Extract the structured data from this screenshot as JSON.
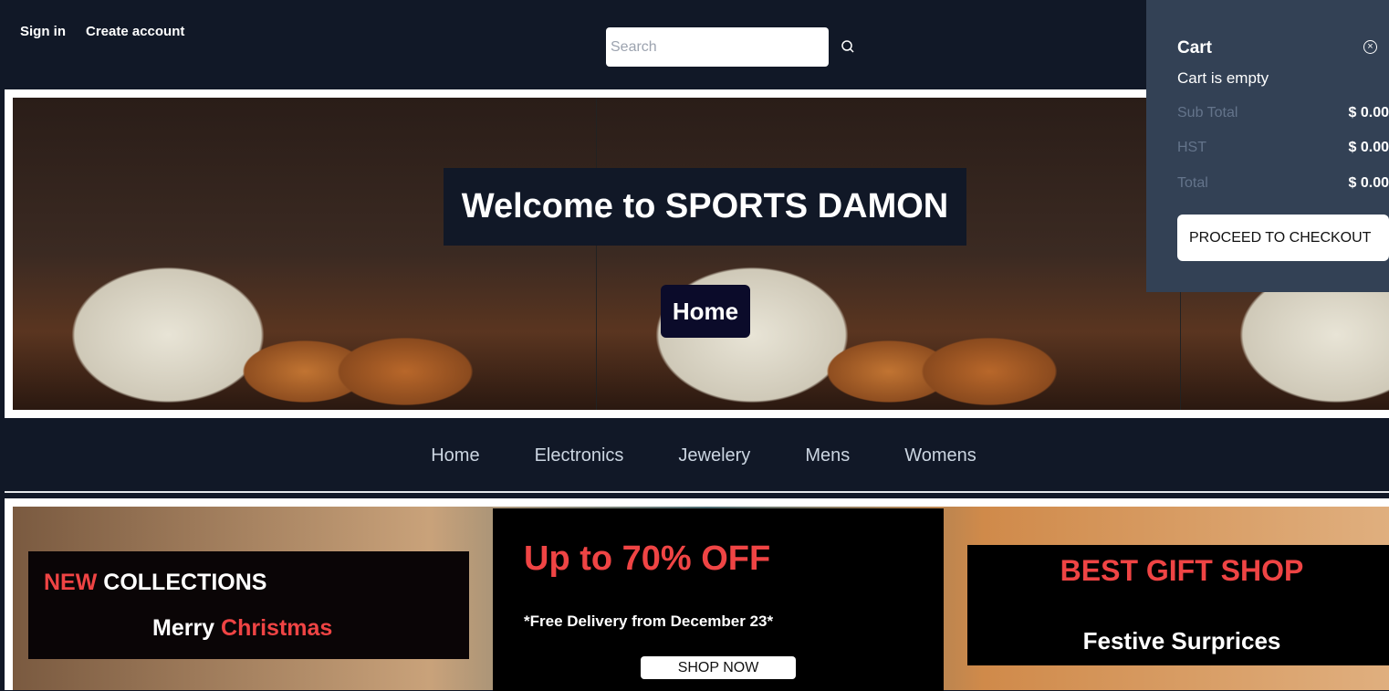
{
  "header": {
    "sign_in": "Sign in",
    "create_account": "Create account",
    "search_placeholder": "Search"
  },
  "hero": {
    "title": "Welcome to SPORTS DAMON",
    "button": "Home"
  },
  "nav": [
    "Home",
    "Electronics",
    "Jewelery",
    "Mens",
    "Womens"
  ],
  "promos": {
    "p1": {
      "new": "NEW",
      "collections": " COLLECTIONS",
      "merry": "Merry ",
      "christmas": "Christmas"
    },
    "p2": {
      "title": "Up to 70% OFF",
      "subtitle": "*Free Delivery from December 23*",
      "button": "SHOP NOW"
    },
    "p3": {
      "title": "BEST GIFT SHOP",
      "subtitle": "Festive Surprices"
    }
  },
  "cart": {
    "title": "Cart",
    "empty": "Cart is empty",
    "rows": [
      {
        "label": "Sub Total",
        "value": "$ 0.00"
      },
      {
        "label": "HST",
        "value": "$ 0.00"
      },
      {
        "label": "Total",
        "value": "$ 0.00"
      }
    ],
    "checkout": "PROCEED TO CHECKOUT"
  }
}
